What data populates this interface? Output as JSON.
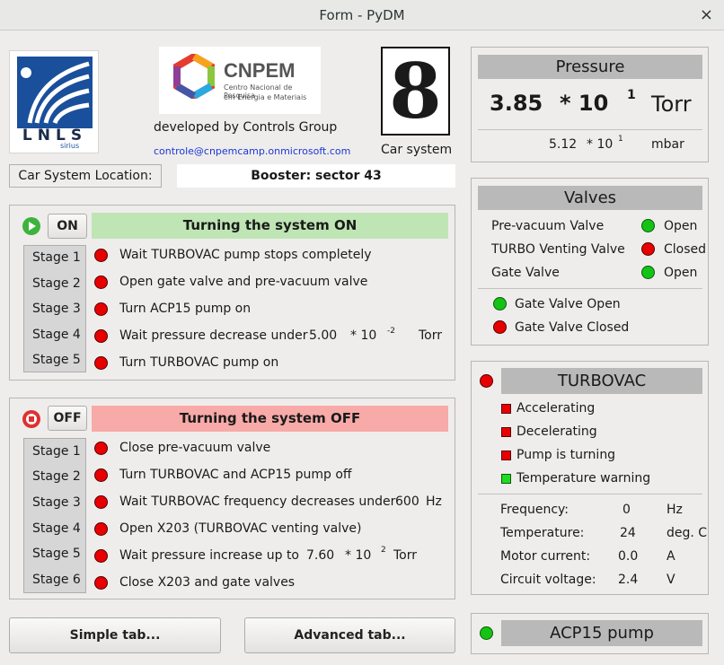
{
  "window": {
    "title": "Form - PyDM",
    "close_glyph": "×"
  },
  "header": {
    "lnls_logo_text": "LNLS",
    "lnls_logo_subtext": "sirius",
    "cnpem_logo_text": "CNPEM",
    "cnpem_logo_subtext_1": "Centro Nacional de Pesquisa",
    "cnpem_logo_subtext_2": "em Energia e Materiais",
    "developed_by": "developed by Controls Group",
    "email": "controle@cnpemcamp.onmicrosoft.com",
    "car_number": "8",
    "car_label": "Car system"
  },
  "location": {
    "label": "Car System Location:",
    "value": "Booster: sector 43"
  },
  "on_sequence": {
    "button_label": "ON",
    "title": "Turning the system ON",
    "title_color": "#bfe5b5",
    "steps": [
      {
        "stage": "Stage 1",
        "text": "Wait TURBOVAC pump stops completely"
      },
      {
        "stage": "Stage 2",
        "text": "Open gate valve and pre-vacuum valve"
      },
      {
        "stage": "Stage 3",
        "text": "Turn ACP15 pump on"
      },
      {
        "stage": "Stage 4",
        "text": "Wait pressure decrease under",
        "value": "5.00",
        "mult": "* 10",
        "exp": "-2",
        "unit": "Torr"
      },
      {
        "stage": "Stage 5",
        "text": "Turn TURBOVAC pump on"
      }
    ]
  },
  "off_sequence": {
    "button_label": "OFF",
    "title": "Turning the system OFF",
    "title_color": "#f8aaa8",
    "steps": [
      {
        "stage": "Stage 1",
        "text": "Close pre-vacuum valve"
      },
      {
        "stage": "Stage 2",
        "text": "Turn TURBOVAC and ACP15 pump off"
      },
      {
        "stage": "Stage 3",
        "text": "Wait TURBOVAC frequency decreases under",
        "value": "600",
        "unit": "Hz"
      },
      {
        "stage": "Stage 4",
        "text": "Open X203 (TURBOVAC venting valve)"
      },
      {
        "stage": "Stage 5",
        "text": "Wait pressure increase up to",
        "value": "7.60",
        "mult": "* 10",
        "exp": "2",
        "unit": "Torr"
      },
      {
        "stage": "Stage 6",
        "text": "Close X203 and gate valves"
      }
    ]
  },
  "bottom_buttons": {
    "simple": "Simple tab...",
    "advanced": "Advanced tab..."
  },
  "pressure": {
    "title": "Pressure",
    "main_value": "3.85",
    "main_mult": "* 10",
    "main_exp": "1",
    "main_unit": "Torr",
    "sub_value": "5.12",
    "sub_mult": "* 10",
    "sub_exp": "1",
    "sub_unit": "mbar"
  },
  "valves": {
    "title": "Valves",
    "items": [
      {
        "label": "Pre-vacuum Valve",
        "state": "Open",
        "color": "green"
      },
      {
        "label": "TURBO Venting Valve",
        "state": "Closed",
        "color": "red"
      },
      {
        "label": "Gate Valve",
        "state": "Open",
        "color": "green"
      }
    ],
    "indicators": [
      {
        "label": "Gate Valve Open",
        "color": "green"
      },
      {
        "label": "Gate Valve Closed",
        "color": "red"
      }
    ]
  },
  "turbovac": {
    "title": "TURBOVAC",
    "status_color": "red",
    "flags": [
      {
        "label": "Accelerating",
        "color": "red"
      },
      {
        "label": "Decelerating",
        "color": "red"
      },
      {
        "label": "Pump is turning",
        "color": "red"
      },
      {
        "label": "Temperature warning",
        "color": "green"
      }
    ],
    "readings": [
      {
        "label": "Frequency:",
        "value": "0",
        "unit": "Hz"
      },
      {
        "label": "Temperature:",
        "value": "24",
        "unit": "deg. C"
      },
      {
        "label": "Motor current:",
        "value": "0.0",
        "unit": "A"
      },
      {
        "label": "Circuit voltage:",
        "value": "2.4",
        "unit": "V"
      }
    ]
  },
  "acp15": {
    "title": "ACP15 pump",
    "status_color": "green"
  }
}
